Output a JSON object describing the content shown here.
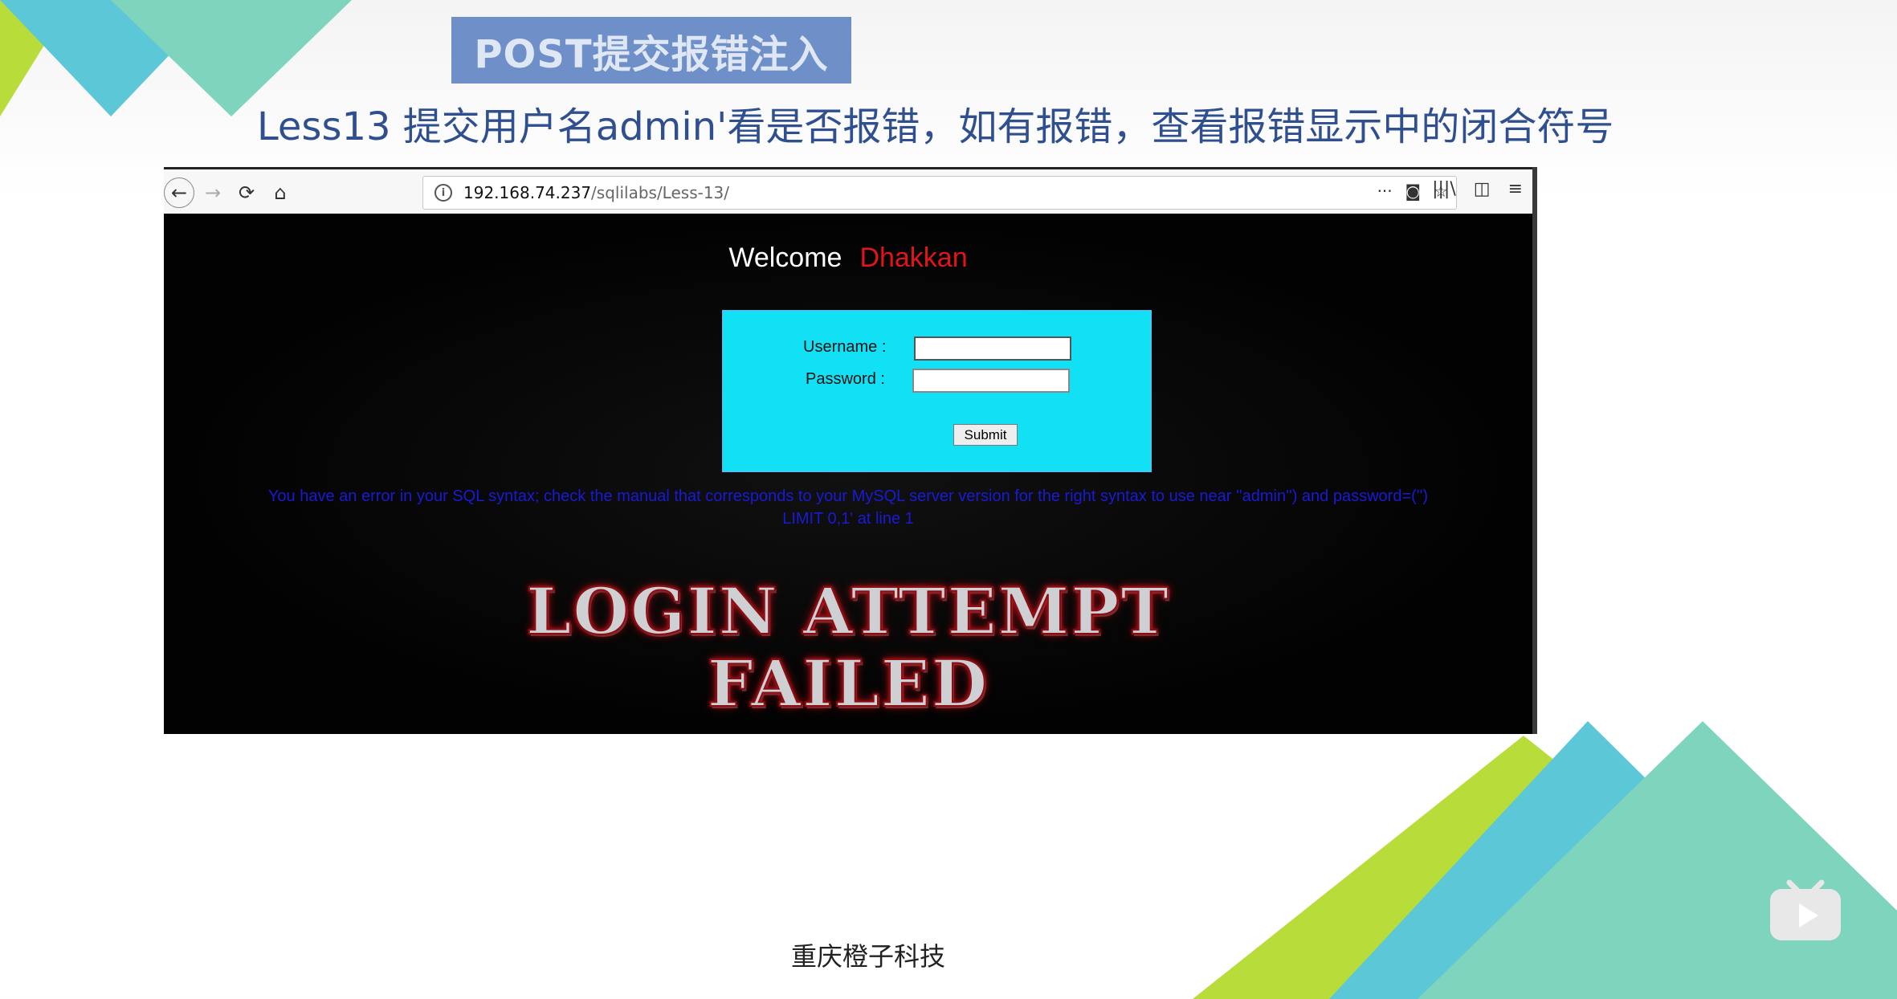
{
  "slide": {
    "title": "POST提交报错注入",
    "subtitle": "Less13  提交用户名admin'看是否报错，如有报错，查看报错显示中的闭合符号",
    "footer": "重庆橙子科技",
    "colors": {
      "title_bg": "#6f8fc8",
      "subtitle": "#2f4f8f",
      "green": "#b8dd3b",
      "blue": "#5cc7d6",
      "teal": "#7fd4bd"
    }
  },
  "browser": {
    "nav": {
      "back": "←",
      "forward": "→",
      "reload": "⟳",
      "home": "⌂"
    },
    "url": {
      "host": "192.168.74.237",
      "path": "/sqlilabs/Less-13/"
    },
    "url_actions": {
      "more": "···",
      "pocket": "◙",
      "star": "☆"
    },
    "right_icons": {
      "library": "|||\\",
      "sidebar": "◫",
      "menu": "≡"
    }
  },
  "page": {
    "welcome": "Welcome",
    "name": "Dhakkan",
    "username_label": "Username :",
    "password_label": "Password :",
    "username_value": "",
    "password_value": "",
    "submit": "Submit",
    "error_line1": "You have an error in your SQL syntax; check the manual that corresponds to your MySQL server version for the right syntax to use near ''admin'') and password=('')",
    "error_line2": "LIMIT 0,1' at line 1",
    "banner_line1": "LOGIN ATTEMPT",
    "banner_line2": "FAILED"
  }
}
